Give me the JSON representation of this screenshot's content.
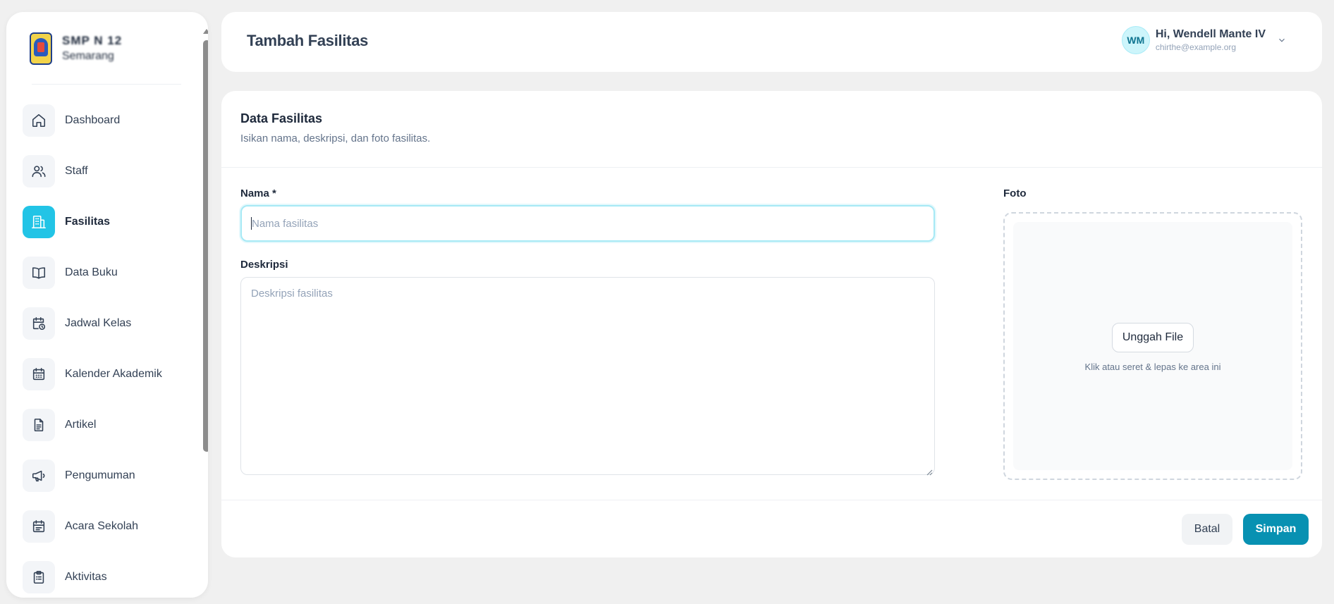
{
  "brand": {
    "line1": "SMP N 12",
    "line2": "Semarang"
  },
  "sidebar": {
    "items": [
      {
        "label": "Dashboard",
        "icon": "home-icon",
        "active": false
      },
      {
        "label": "Staff",
        "icon": "users-icon",
        "active": false
      },
      {
        "label": "Fasilitas",
        "icon": "building-icon",
        "active": true
      },
      {
        "label": "Data Buku",
        "icon": "book-icon",
        "active": false
      },
      {
        "label": "Jadwal Kelas",
        "icon": "calendar-clock-icon",
        "active": false
      },
      {
        "label": "Kalender Akademik",
        "icon": "calendar-icon",
        "active": false
      },
      {
        "label": "Artikel",
        "icon": "document-icon",
        "active": false
      },
      {
        "label": "Pengumuman",
        "icon": "megaphone-icon",
        "active": false
      },
      {
        "label": "Acara Sekolah",
        "icon": "calendar-event-icon",
        "active": false
      },
      {
        "label": "Aktivitas",
        "icon": "clipboard-icon",
        "active": false
      }
    ]
  },
  "header": {
    "title": "Tambah Fasilitas",
    "user": {
      "initials": "WM",
      "name": "Hi, Wendell Mante IV",
      "email": "chirthe@example.org"
    }
  },
  "form": {
    "title": "Data Fasilitas",
    "subtitle": "Isikan nama, deskripsi, dan foto fasilitas.",
    "nama": {
      "label": "Nama *",
      "placeholder": "Nama fasilitas",
      "value": ""
    },
    "deskripsi": {
      "label": "Deskripsi",
      "placeholder": "Deskripsi fasilitas",
      "value": ""
    },
    "foto": {
      "label": "Foto",
      "upload_label": "Unggah File",
      "hint": "Klik atau seret & lepas ke area ini"
    },
    "cancel_label": "Batal",
    "save_label": "Simpan"
  },
  "colors": {
    "accent": "#22c4e6",
    "primary_button": "#0891b2",
    "background": "#f0f0f0"
  }
}
